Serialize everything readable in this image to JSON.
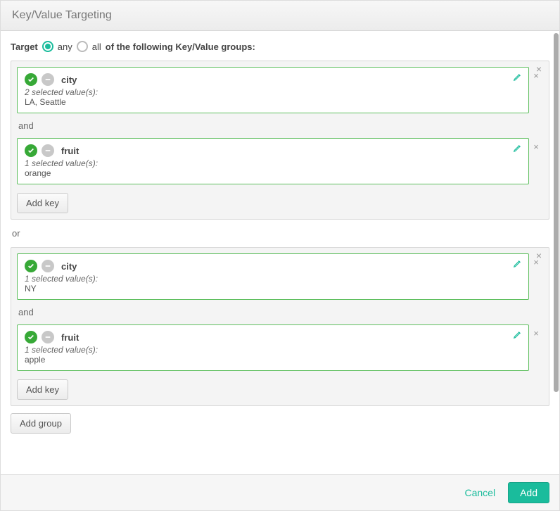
{
  "header": {
    "title": "Key/Value Targeting"
  },
  "target_row": {
    "prefix": "Target",
    "option_any": "any",
    "option_all": "all",
    "suffix": "of the following Key/Value groups:",
    "selected": "any"
  },
  "groups": [
    {
      "keys": [
        {
          "name": "city",
          "selected_label": "2 selected value(s):",
          "values": "LA, Seattle"
        },
        {
          "name": "fruit",
          "selected_label": "1 selected value(s):",
          "values": "orange"
        }
      ]
    },
    {
      "keys": [
        {
          "name": "city",
          "selected_label": "1 selected value(s):",
          "values": "NY"
        },
        {
          "name": "fruit",
          "selected_label": "1 selected value(s):",
          "values": "apple"
        }
      ]
    }
  ],
  "labels": {
    "and": "and",
    "or": "or",
    "add_key": "Add key",
    "add_group": "Add group"
  },
  "footer": {
    "cancel": "Cancel",
    "add": "Add"
  }
}
